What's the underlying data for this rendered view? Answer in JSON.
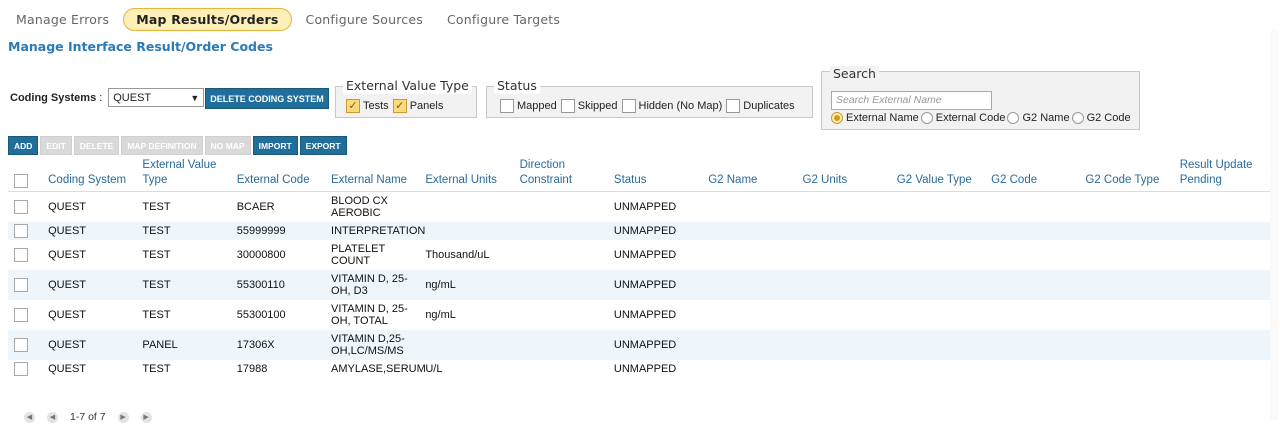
{
  "tabs": [
    {
      "label": "Manage Errors"
    },
    {
      "label": "Map Results/Orders"
    },
    {
      "label": "Configure Sources"
    },
    {
      "label": "Configure Targets"
    }
  ],
  "page_title": "Manage Interface Result/Order Codes",
  "coding": {
    "label": "Coding Systems",
    "sep": ":",
    "selected": "QUEST",
    "delete_label": "DELETE CODING SYSTEM"
  },
  "ext_value_type": {
    "legend": "External Value Type",
    "tests": "Tests",
    "panels": "Panels"
  },
  "status_filter": {
    "legend": "Status",
    "mapped": "Mapped",
    "skipped": "Skipped",
    "hidden": "Hidden (No Map)",
    "duplicates": "Duplicates"
  },
  "search": {
    "legend": "Search",
    "placeholder": "Search External Name",
    "opt_ext_name": "External Name",
    "opt_ext_code": "External Code",
    "opt_g2_name": "G2 Name",
    "opt_g2_code": "G2 Code"
  },
  "toolbar": {
    "add": "ADD",
    "edit": "EDIT",
    "delete": "DELETE",
    "map_def": "MAP DEFINITION",
    "no_map": "NO MAP",
    "import": "IMPORT",
    "export": "EXPORT"
  },
  "columns": {
    "coding_system": "Coding System",
    "ext_value_type": "External Value Type",
    "ext_code": "External Code",
    "ext_name": "External Name",
    "ext_units": "External Units",
    "direction": "Direction Constraint",
    "status": "Status",
    "g2_name": "G2 Name",
    "g2_units": "G2 Units",
    "g2_value_type": "G2 Value Type",
    "g2_code": "G2 Code",
    "g2_code_type": "G2 Code Type",
    "result_update": "Result Update Pending"
  },
  "rows": [
    {
      "coding_system": "QUEST",
      "type": "TEST",
      "code": "BCAER",
      "name": "BLOOD CX AEROBIC",
      "units": "",
      "status": "UNMAPPED"
    },
    {
      "coding_system": "QUEST",
      "type": "TEST",
      "code": "55999999",
      "name": "INTERPRETATION",
      "units": "",
      "status": "UNMAPPED"
    },
    {
      "coding_system": "QUEST",
      "type": "TEST",
      "code": "30000800",
      "name": "PLATELET COUNT",
      "units": "Thousand/uL",
      "status": "UNMAPPED"
    },
    {
      "coding_system": "QUEST",
      "type": "TEST",
      "code": "55300110",
      "name": "VITAMIN D, 25-OH, D3",
      "units": "ng/mL",
      "status": "UNMAPPED"
    },
    {
      "coding_system": "QUEST",
      "type": "TEST",
      "code": "55300100",
      "name": "VITAMIN D, 25-OH, TOTAL",
      "units": "ng/mL",
      "status": "UNMAPPED"
    },
    {
      "coding_system": "QUEST",
      "type": "PANEL",
      "code": "17306X",
      "name": "VITAMIN D,25-OH,LC/MS/MS",
      "units": "",
      "status": "UNMAPPED"
    },
    {
      "coding_system": "QUEST",
      "type": "TEST",
      "code": "17988",
      "name": "AMYLASE,SERUM",
      "units": "U/L",
      "status": "UNMAPPED"
    }
  ],
  "pager": {
    "text": "1-7 of 7"
  },
  "colors": {
    "accent": "#2a7ab8",
    "tab_active_bg": "#fcefb7",
    "button": "#1f6f9a",
    "row_alt": "#eef6fb"
  }
}
